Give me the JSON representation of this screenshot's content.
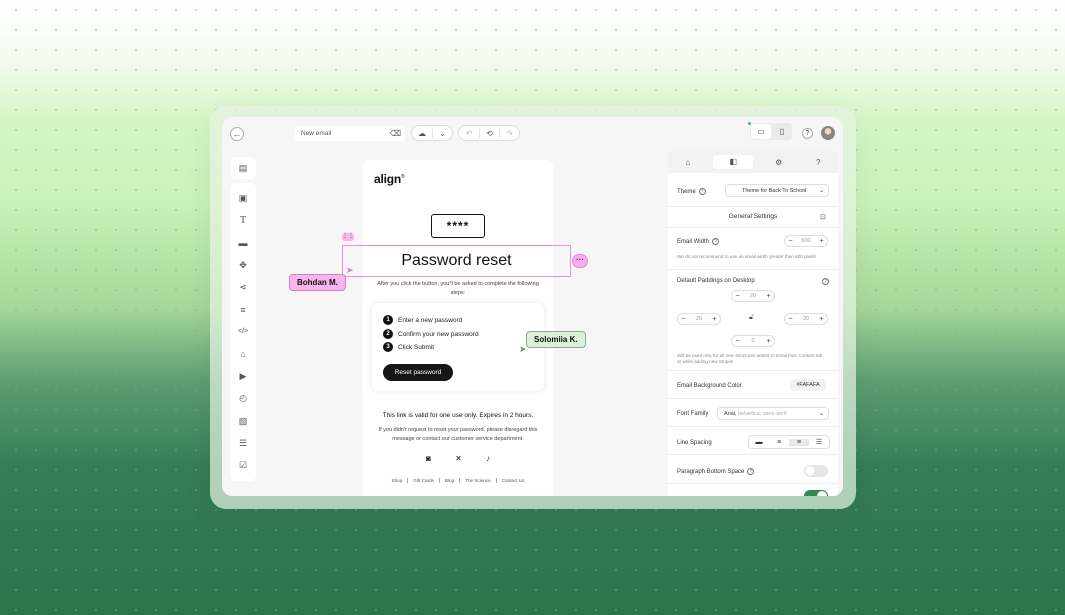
{
  "topbar": {
    "back_icon": "arrow-left-icon",
    "email_name": "New email",
    "clear_icon": "clear-icon",
    "help_symbol": "?"
  },
  "left_toolbar": {
    "icons": [
      "template-icon",
      "image-icon",
      "text-icon",
      "button-icon",
      "spacer-icon",
      "social-share-icon",
      "divider-icon",
      "html-code-icon",
      "menu-icon",
      "video-icon",
      "timer-icon",
      "image-text-icon",
      "stripe-icon",
      "checklist-icon"
    ]
  },
  "email": {
    "logo": "align",
    "logo_mark": "®",
    "code": "****",
    "heading": "Password reset",
    "intro": "After you click the button, you'll be asked to complete the following steps:",
    "steps": [
      {
        "num": "1",
        "text": "Enter a new password"
      },
      {
        "num": "2",
        "text": "Confirm your new password"
      },
      {
        "num": "3",
        "text": "Click Submit"
      }
    ],
    "button_label": "Reset password",
    "valid_note": "This link is valid for one use only. Expires in 2 hours.",
    "ignore_note": "If you didn't request to reset your password, please disregard this message or contact our customer service department.",
    "socials": [
      "instagram-icon",
      "x-icon",
      "tiktok-icon"
    ],
    "footer_links": [
      "Shop",
      "Gift Cards",
      "Blog",
      "The Science",
      "Contact Us"
    ]
  },
  "collaborators": [
    {
      "name": "Bohdan M.",
      "color": "#f7b5ee"
    },
    {
      "name": "Solomiia K.",
      "color": "#dcefd9"
    }
  ],
  "panel": {
    "tabs": [
      "home-icon",
      "design-icon",
      "settings-icon",
      "help-icon"
    ],
    "theme_label": "Theme",
    "theme_value": "Theme for Back To School",
    "section_title": "General Settings",
    "email_width_label": "Email Width",
    "email_width_value": "600",
    "email_width_note": "We do not recommend to use an email width greater than 600 pixels",
    "paddings_label": "Default Paddings on Desktop",
    "padding_top": "20",
    "padding_left": "20",
    "padding_right": "20",
    "padding_bottom": "0",
    "paddings_note": "Will be used only for all new structures added to email from Content tab or while adding new Stripes",
    "bg_color_label": "Email Background Color",
    "bg_color_value": "#FAFAFA",
    "font_family_label": "Font Family",
    "font_family_value": "Arial,",
    "font_family_fallback": "helvetica, sans-serif",
    "line_spacing_label": "Line Spacing",
    "paragraph_label": "Paragraph Bottom Space",
    "paragraph_toggle": false,
    "extra_toggle": true
  }
}
